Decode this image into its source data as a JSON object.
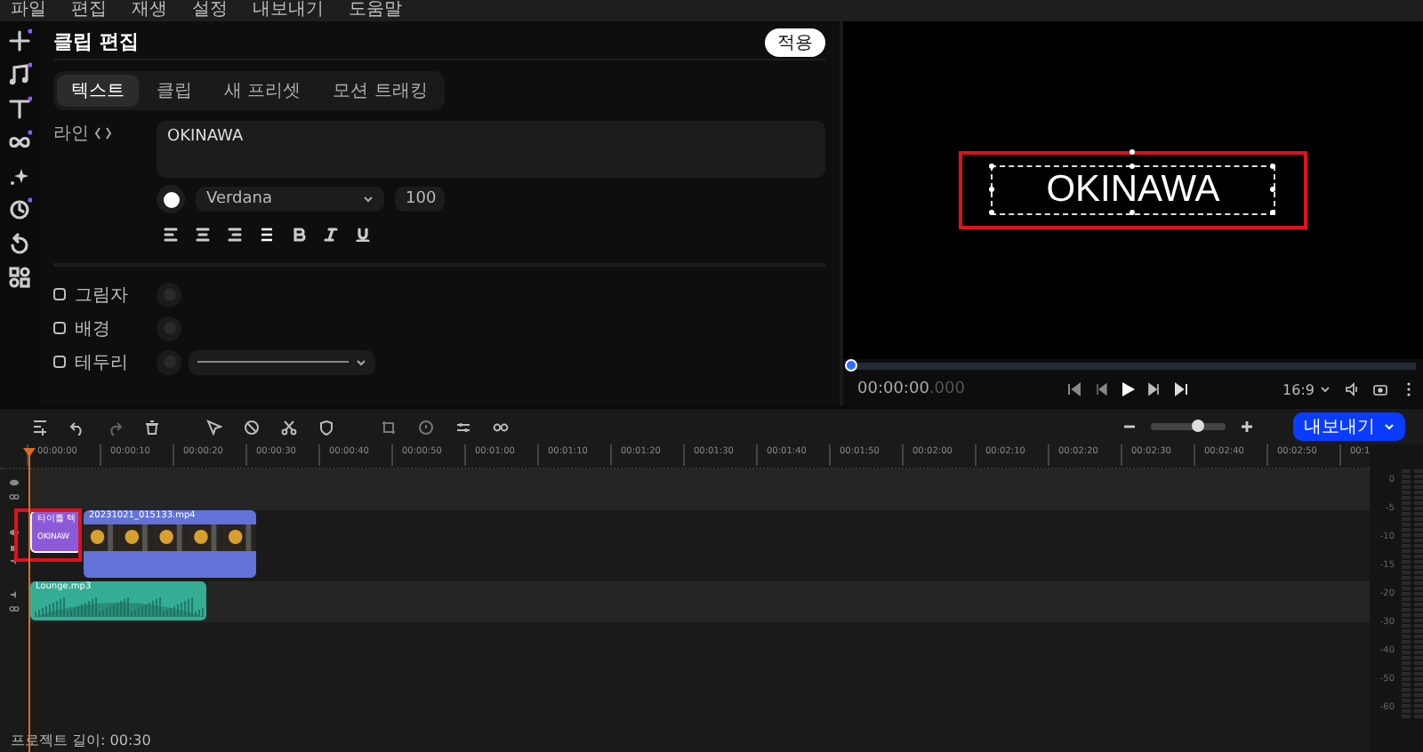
{
  "menu": [
    "파일",
    "편집",
    "재생",
    "설정",
    "내보내기",
    "도움말"
  ],
  "rail": [
    {
      "kind": "add",
      "badge": true
    },
    {
      "kind": "music",
      "badge": true
    },
    {
      "kind": "text",
      "badge": true
    },
    {
      "kind": "link",
      "badge": true
    },
    {
      "kind": "sparkle",
      "badge": false
    },
    {
      "kind": "sticker",
      "badge": true
    },
    {
      "kind": "rotate",
      "badge": false
    },
    {
      "kind": "grid",
      "badge": false
    }
  ],
  "editor": {
    "title": "클립 편집",
    "apply": "적용",
    "tabs": [
      {
        "label": "텍스트",
        "selected": true
      },
      {
        "label": "클립",
        "selected": false
      },
      {
        "label": "새 프리셋",
        "selected": false
      },
      {
        "label": "모션 트래킹",
        "selected": false
      }
    ],
    "line_label": "라인",
    "text_value": "OKINAWA",
    "color": "#ffffff",
    "font": "Verdana",
    "size": "100",
    "format": [
      {
        "kind": "align-left"
      },
      {
        "kind": "align-center"
      },
      {
        "kind": "align-right"
      },
      {
        "kind": "justify"
      },
      {
        "kind": "bold"
      },
      {
        "kind": "italic"
      },
      {
        "kind": "underline"
      }
    ],
    "options": [
      {
        "label": "그림자",
        "checked": false,
        "kind": "swatch"
      },
      {
        "label": "배경",
        "checked": false,
        "kind": "swatch"
      },
      {
        "label": "테두리",
        "checked": false,
        "kind": "stroke"
      }
    ]
  },
  "preview": {
    "caption": "OKINAWA",
    "highlighted": true,
    "position": {
      "level": 0
    },
    "time": "00:00:00",
    "time_fraction": ".000",
    "ratio": "16:9"
  },
  "timeline": {
    "export": "내보내기",
    "zoom": {
      "level": 0.62
    },
    "ruler": [
      "00:00:00",
      "00:00:10",
      "00:00:20",
      "00:00:30",
      "00:00:40",
      "00:00:50",
      "00:01:00",
      "00:01:10",
      "00:01:20",
      "00:01:30",
      "00:01:40",
      "00:01:50",
      "00:02:00",
      "00:02:10",
      "00:02:20",
      "00:02:30",
      "00:02:40",
      "00:02:50",
      "00:1"
    ],
    "tracks": [
      {
        "kind": "empty"
      },
      {
        "kind": "video",
        "clips": [
          {
            "kind": "title",
            "name": "타이틀 텍",
            "caption": "OKINAW",
            "selected": true,
            "highlighted": true
          },
          {
            "kind": "video",
            "name": "20231021_015133.mp4",
            "selected": false,
            "highlighted": false
          }
        ]
      },
      {
        "kind": "audio",
        "clips": [
          {
            "kind": "audio",
            "name": "Lounge.mp3",
            "selected": false,
            "highlighted": false
          }
        ]
      }
    ],
    "meter": [
      "0",
      "-5",
      "-10",
      "-15",
      "-20",
      "-30",
      "-40",
      "-50",
      "-60"
    ],
    "status": "프로젝트 길이: 00:30"
  }
}
